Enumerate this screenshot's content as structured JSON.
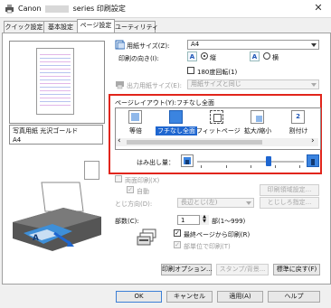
{
  "window": {
    "title_prefix": "Canon",
    "title_suffix": "series 印刷設定",
    "close_glyph": "✕"
  },
  "tabs": [
    {
      "label": "クイック設定"
    },
    {
      "label": "基本設定"
    },
    {
      "label": "ページ設定"
    },
    {
      "label": "ユーティリティ"
    }
  ],
  "preview": {
    "media_label": "写真用紙 光沢ゴールド",
    "paper_size": "A4"
  },
  "page_size": {
    "label": "用紙サイズ(Z):",
    "value": "A4"
  },
  "orientation": {
    "label": "印刷の向き(I):",
    "portrait": "縦",
    "landscape": "横",
    "selected": "portrait",
    "portrait_glyph": "A",
    "landscape_glyph": "A"
  },
  "rotate180": {
    "label": "180度回転(1)",
    "checked": false
  },
  "output_size": {
    "label": "出力用紙サイズ(E):",
    "value": "用紙サイズと同じ"
  },
  "page_layout": {
    "label": "ページレイアウト(Y):フチなし全面",
    "items": [
      {
        "label": "等倍"
      },
      {
        "label": "フチなし全面"
      },
      {
        "label": "フィットページ"
      },
      {
        "label": "拡大/縮小"
      },
      {
        "label": "割付け"
      }
    ],
    "selected_index": 1,
    "tile_number": "2",
    "scroll_left": "‹",
    "scroll_right": "›"
  },
  "extension": {
    "label": "はみ出し量：",
    "level": 0.67
  },
  "duplex": {
    "label": "両面印刷(X)",
    "auto_label": "自動",
    "area_button": "印刷領域設定...",
    "binding_label": "とじ方向(D):",
    "binding_value": "長辺とじ(左)",
    "margin_button": "とじしろ指定..."
  },
  "copies": {
    "label": "部数(C):",
    "value": "1",
    "range": "部(1～999)",
    "last_page_first": "最終ページから印刷(R)",
    "collate": "部単位で印刷(T)"
  },
  "actions": {
    "print_options": "印刷オプション...",
    "stamp": "スタンプ/背景...",
    "defaults": "標準に戻す(F)"
  },
  "footer": {
    "ok": "OK",
    "cancel": "キャンセル",
    "apply": "適用(A)",
    "help": "ヘルプ"
  }
}
